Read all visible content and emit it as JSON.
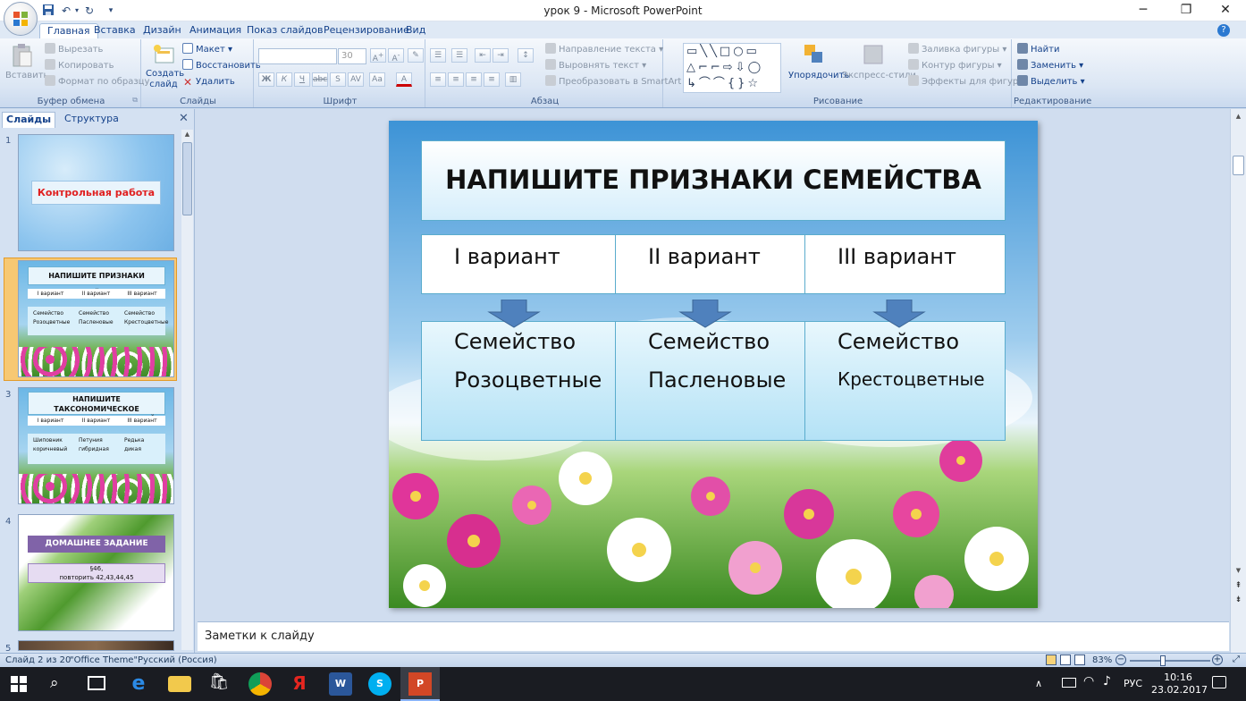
{
  "window": {
    "title": "урок 9 - Microsoft PowerPoint"
  },
  "quick_access": [
    "save-icon",
    "undo-icon",
    "redo-icon",
    "customize-icon"
  ],
  "tabs": [
    "Главная",
    "Вставка",
    "Дизайн",
    "Анимация",
    "Показ слайдов",
    "Рецензирование",
    "Вид"
  ],
  "ribbon": {
    "clipboard": {
      "label": "Буфер обмена",
      "paste": "Вставить",
      "cut": "Вырезать",
      "copy": "Копировать",
      "format_painter": "Формат по образцу"
    },
    "slides": {
      "label": "Слайды",
      "new_slide": "Создать слайд",
      "layout": "Макет",
      "reset": "Восстановить",
      "delete": "Удалить"
    },
    "font": {
      "label": "Шрифт",
      "size": "30"
    },
    "paragraph": {
      "label": "Абзац",
      "text_direction": "Направление текста",
      "align_text": "Выровнять текст",
      "smartart": "Преобразовать в SmartArt"
    },
    "drawing": {
      "label": "Рисование",
      "arrange": "Упорядочить",
      "quick_styles": "Экспресс-стили",
      "shape_fill": "Заливка фигуры",
      "shape_outline": "Контур фигуры",
      "shape_effects": "Эффекты для фигур"
    },
    "editing": {
      "label": "Редактирование",
      "find": "Найти",
      "replace": "Заменить",
      "select": "Выделить"
    }
  },
  "panel": {
    "tab_slides": "Слайды",
    "tab_outline": "Структура"
  },
  "thumbnails": [
    {
      "num": "1",
      "title": "Контрольная работа"
    },
    {
      "num": "2",
      "title": "НАПИШИТЕ ПРИЗНАКИ  СЕМЕЙСТВА",
      "cols": [
        "I вариант",
        "II вариант",
        "III вариант"
      ],
      "cells": [
        "Семейство Розоцветные",
        "Семейство Пасленовые",
        "Семейство Крестоцветные"
      ]
    },
    {
      "num": "3",
      "title": "НАПИШИТЕ ТАКСОНОМИЧЕСКОЕ ПОЛОЖЕНИЕ ДЛЯ РАСТЕНИЙ:",
      "cols": [
        "I вариант",
        "II вариант",
        "III вариант"
      ],
      "cells": [
        "Шиповник коричневый",
        "Петуния гибридная",
        "Редька дикая"
      ]
    },
    {
      "num": "4",
      "title": "ДОМАШНЕЕ ЗАДАНИЕ",
      "line1": "§46,",
      "line2": "повторить 42,43,44,45"
    },
    {
      "num": "5"
    }
  ],
  "slide": {
    "title": "НАПИШИТЕ ПРИЗНАКИ СЕМЕЙСТВА",
    "variants": [
      "I вариант",
      "II вариант",
      "III вариант"
    ],
    "families": [
      {
        "line1": "Семейство",
        "line2": "Розоцветные"
      },
      {
        "line1": "Семейство",
        "line2": "Пасленовые"
      },
      {
        "line1": "Семейство",
        "line2": "Крестоцветные"
      }
    ]
  },
  "notes": {
    "placeholder": "Заметки к слайду"
  },
  "status": {
    "slide": "Слайд 2 из 20",
    "theme": "\"Office Theme\"",
    "language": "Русский (Россия)",
    "zoom": "83%",
    "zoom_level_percent": 83
  },
  "taskbar": {
    "lang": "РУС",
    "time": "10:16",
    "date": "23.02.2017"
  },
  "colors": {
    "ribbon": "#dbe6f4",
    "title_text": "#15428b",
    "slide_border": "#5aaccd",
    "arrow": "#4f81bd"
  }
}
